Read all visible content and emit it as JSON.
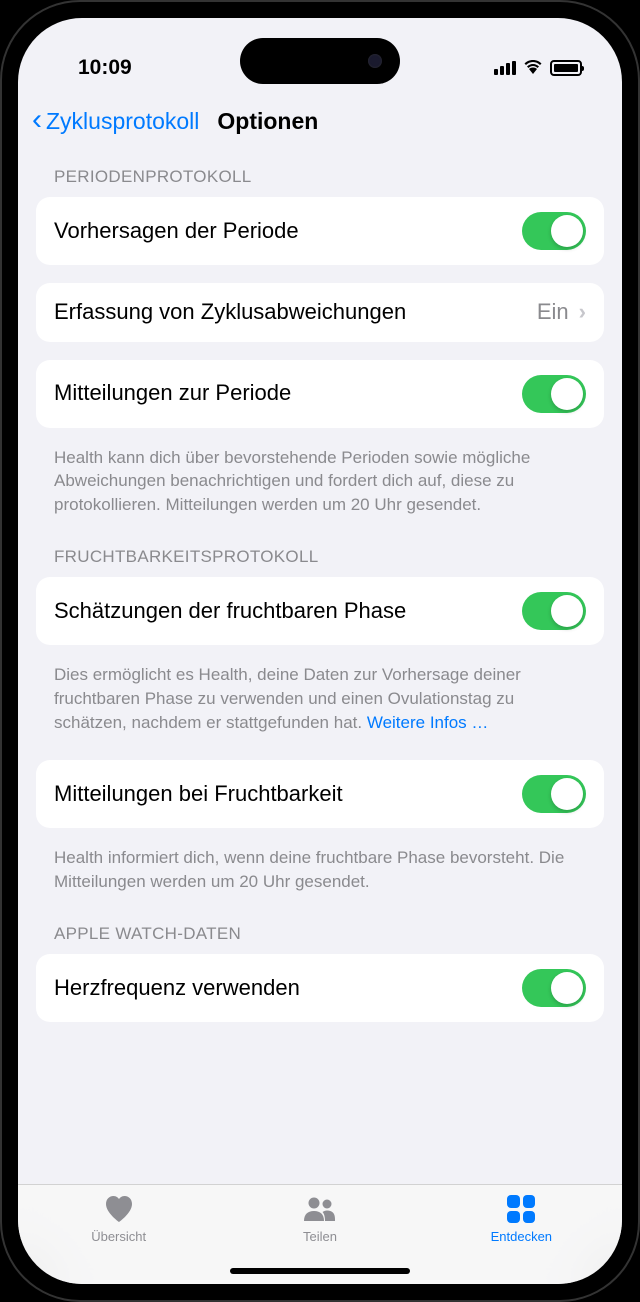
{
  "status": {
    "time": "10:09"
  },
  "nav": {
    "back_label": "Zyklusprotokoll",
    "title": "Optionen"
  },
  "sections": {
    "period": {
      "header": "PERIODENPROTOKOLL",
      "row1_label": "Vorhersagen der Periode",
      "row2_label": "Erfassung von Zyklusabweichungen",
      "row2_value": "Ein",
      "row3_label": "Mitteilungen zur Periode",
      "footer": "Health kann dich über bevorstehende Perioden sowie mögliche Abweichungen benachrichtigen und fordert dich auf, diese zu protokollieren. Mitteilungen werden um 20 Uhr gesendet."
    },
    "fertility": {
      "header": "FRUCHTBARKEITSPROTOKOLL",
      "row1_label": "Schätzungen der fruchtbaren Phase",
      "footer1_text": "Dies ermöglicht es Health, deine Daten zur Vorhersage deiner fruchtbaren Phase zu verwenden und einen Ovulationstag zu schätzen, nachdem er stattgefunden hat. ",
      "footer1_link": "Weitere Infos …",
      "row2_label": "Mitteilungen bei Fruchtbarkeit",
      "footer2": "Health informiert dich, wenn deine fruchtbare Phase bevorsteht. Die Mitteilungen werden um 20 Uhr gesendet."
    },
    "watch": {
      "header": "APPLE WATCH-DATEN",
      "row1_label": "Herzfrequenz verwenden"
    }
  },
  "tabs": {
    "overview": "Übersicht",
    "share": "Teilen",
    "discover": "Entdecken"
  }
}
